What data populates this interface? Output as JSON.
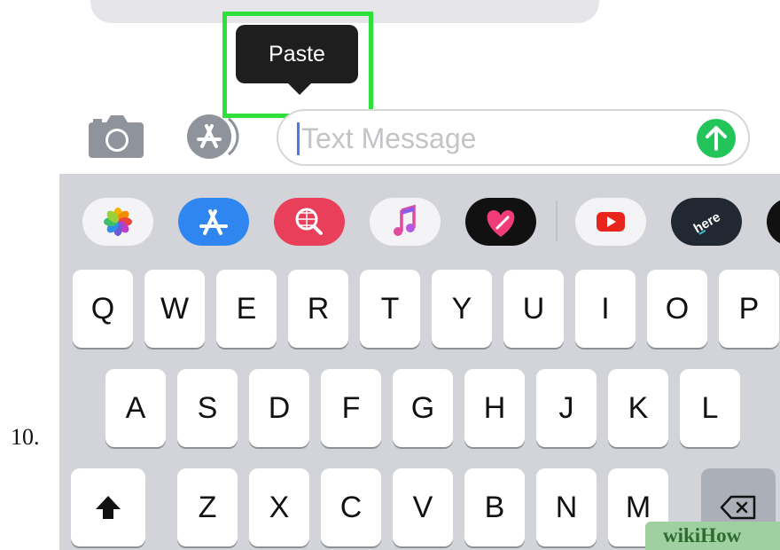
{
  "step": {
    "number": "10."
  },
  "context_menu": {
    "paste_label": "Paste"
  },
  "input_bar": {
    "placeholder": "Text Message"
  },
  "app_drawer": {
    "apps": [
      "photos-icon",
      "app-store-icon",
      "web-search-icon",
      "music-icon",
      "digital-touch-icon",
      "youtube-icon",
      "here-icon",
      "more-app-icon"
    ]
  },
  "keyboard": {
    "row1": [
      "Q",
      "W",
      "E",
      "R",
      "T",
      "Y",
      "U",
      "I",
      "O",
      "P"
    ],
    "row2": [
      "A",
      "S",
      "D",
      "F",
      "G",
      "H",
      "J",
      "K",
      "L"
    ],
    "row3": [
      "Z",
      "X",
      "C",
      "V",
      "B",
      "N",
      "M"
    ],
    "shift_icon": "shift-arrow-icon",
    "delete_icon": "backspace-icon"
  },
  "colors": {
    "highlight": "#2ee03a",
    "send": "#23c55a",
    "keyboard_bg": "#d2d4da",
    "popup": "#1e1e1e"
  },
  "watermark": {
    "text": "wikiHow"
  }
}
